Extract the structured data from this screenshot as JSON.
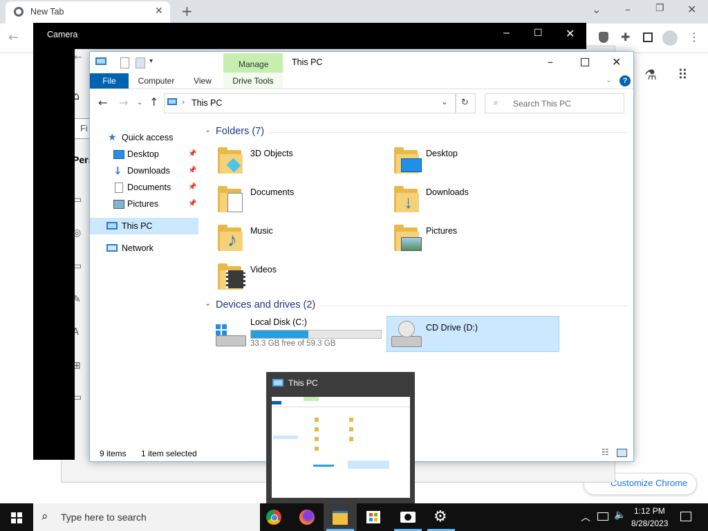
{
  "chrome": {
    "tab_title": "New Tab",
    "customize_label": "Customize Chrome"
  },
  "camera": {
    "title": "Camera"
  },
  "settings": {
    "search_partial": "Fi",
    "heading_partial": "Pers"
  },
  "explorer": {
    "title": "This PC",
    "manage_tab": "Manage",
    "ribbon_tabs": [
      "File",
      "Computer",
      "View",
      "Drive Tools"
    ],
    "address_path": "This PC",
    "search_placeholder": "Search This PC",
    "nav": {
      "quick_access": "Quick access",
      "desktop": "Desktop",
      "downloads": "Downloads",
      "documents": "Documents",
      "pictures": "Pictures",
      "this_pc": "This PC",
      "network": "Network"
    },
    "folders_header": "Folders (7)",
    "folders": [
      "3D Objects",
      "Desktop",
      "Documents",
      "Downloads",
      "Music",
      "Pictures",
      "Videos"
    ],
    "devices_header": "Devices and drives (2)",
    "drives": [
      {
        "name": "Local Disk (C:)",
        "free_text": "33.3 GB free of 59.3 GB",
        "used_fraction": 0.44
      },
      {
        "name": "CD Drive (D:)"
      }
    ],
    "status_items": "9 items",
    "status_selected": "1 item selected"
  },
  "thumbnail": {
    "title": "This PC"
  },
  "taskbar": {
    "search_placeholder": "Type here to search",
    "time": "1:12 PM",
    "date": "8/28/2023"
  },
  "colors": {
    "accent": "#0063b1",
    "manage_green": "#c6efaf",
    "selection": "#cce8ff",
    "drive_bar": "#26a0da",
    "taskbar": "#101010"
  }
}
